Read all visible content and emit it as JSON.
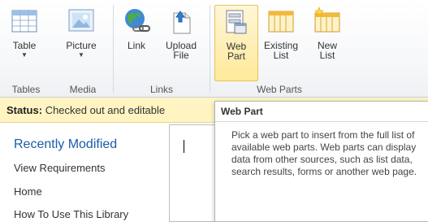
{
  "ribbon": {
    "buttons": {
      "table": "Table",
      "picture": "Picture",
      "link": "Link",
      "upload_file": "Upload\nFile",
      "web_part": "Web\nPart",
      "existing_list": "Existing\nList",
      "new_list": "New\nList"
    },
    "groups": {
      "tables": "Tables",
      "media": "Media",
      "links": "Links",
      "web_parts": "Web Parts"
    },
    "dropdown_arrow": "▼"
  },
  "status": {
    "label": "Status:",
    "text": "Checked out and editable"
  },
  "quick_launch": {
    "heading": "Recently Modified",
    "items": [
      "View Requirements",
      "Home",
      "How To Use This Library"
    ]
  },
  "tooltip": {
    "title": "Web Part",
    "body": "Pick a web part to insert from the full list of available web parts. Web parts can display data from other sources, such as list data, search results, forms or another web page."
  },
  "colors": {
    "status_bg": "#fff4c2",
    "link_blue": "#1a5ca8",
    "selected_button": "#fde99a"
  }
}
